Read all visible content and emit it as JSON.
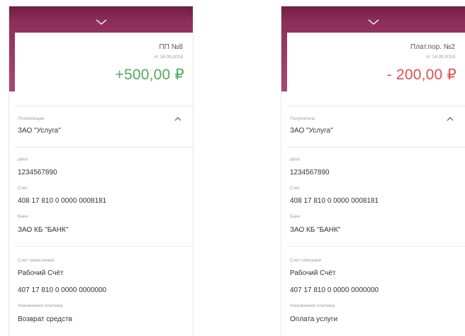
{
  "screens": [
    {
      "document": "ПП №8",
      "date": "от 14.09.2018",
      "amount": "+500,00 ₽",
      "party_label": "Плательщик",
      "party_value": "ЗАО \"Услуга\"",
      "inn_label": "ИНН",
      "inn_value": "1234567890",
      "account_label": "Счет",
      "account_value": "408 17 810 0 0000 0008181",
      "bank_label": "Банк",
      "bank_value": "ЗАО КБ \"БАНК\"",
      "credit_label": "Счет зачисления",
      "credit_name": "Рабочий Счёт",
      "credit_number": "407 17 810 0 0000 0000000",
      "purpose_label": "Назначение платежа",
      "purpose_value": "Возврат средств"
    },
    {
      "document": "Плат.пор. №2",
      "date": "от 14.09.2018",
      "amount": "- 200,00 ₽",
      "party_label": "Получатель",
      "party_value": "ЗАО \"Услуга\"",
      "inn_label": "ИНН",
      "inn_value": "1234567890",
      "account_label": "Счет",
      "account_value": "408 17 810 0 0000 0008181",
      "bank_label": "Банк",
      "bank_value": "ЗАО КБ \"БАНК\"",
      "credit_label": "Счет списания",
      "credit_name": "Рабочий Счёт",
      "credit_number": "407 17 810 0 0000 0000000",
      "purpose_label": "Назначение платежа",
      "purpose_value": "Оплата услуги"
    }
  ],
  "colors": {
    "header": "#8e2f5a",
    "income": "#54a85d",
    "expense": "#d9534f"
  },
  "icons": {
    "collapse": "chevron-down-icon",
    "section_toggle": "chevron-up-icon"
  }
}
